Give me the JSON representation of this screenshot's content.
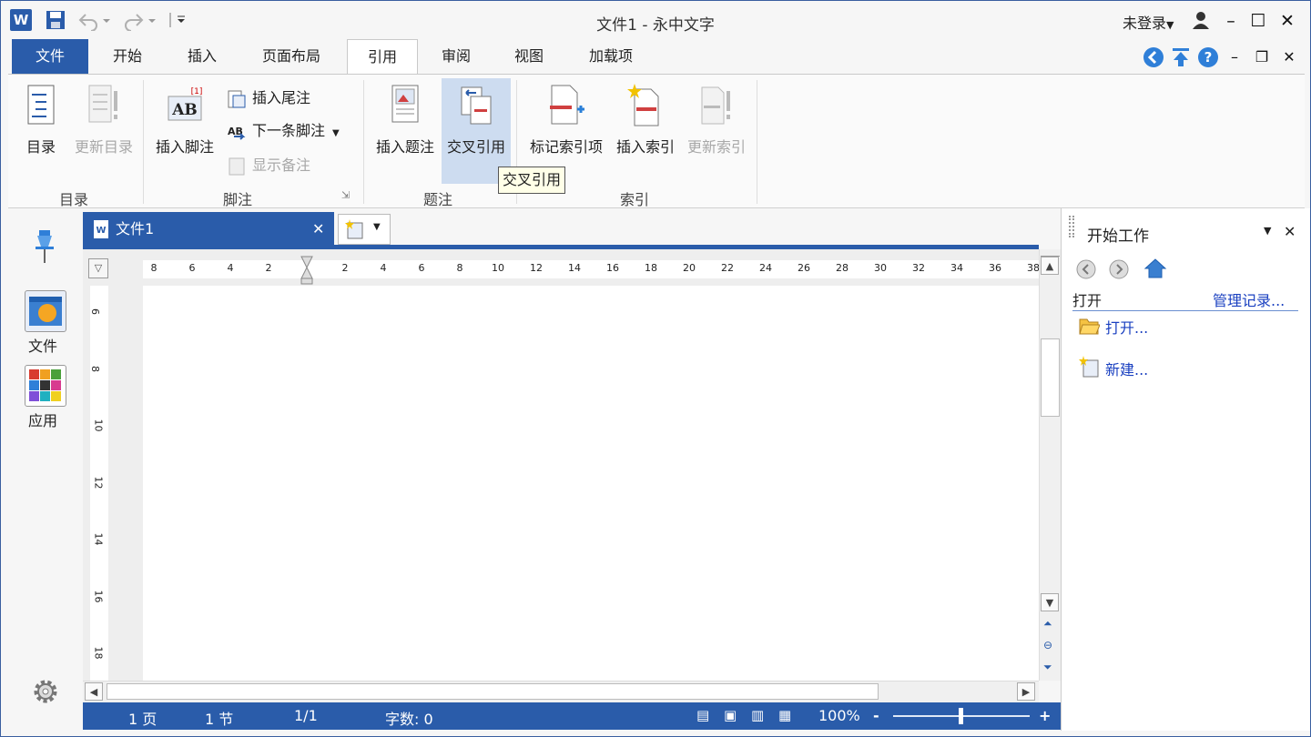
{
  "window": {
    "title": "文件1 - 永中文字",
    "app_logo": "W",
    "login": "未登录",
    "controls": [
      "minimize",
      "maximize",
      "close"
    ]
  },
  "tabs": [
    {
      "label": "文件"
    },
    {
      "label": "开始"
    },
    {
      "label": "插入"
    },
    {
      "label": "页面布局"
    },
    {
      "label": "引用"
    },
    {
      "label": "审阅"
    },
    {
      "label": "视图"
    },
    {
      "label": "加载项"
    }
  ],
  "ribbon": {
    "toc": {
      "label": "目录",
      "update": "更新目录",
      "group": "目录"
    },
    "footnote": {
      "insert": "插入脚注",
      "endnote": "插入尾注",
      "next": "下一条脚注",
      "show": "显示备注",
      "group": "脚注"
    },
    "caption": {
      "insert": "插入题注",
      "cross": "交叉引用",
      "group": "题注"
    },
    "index": {
      "mark": "标记索引项",
      "insert": "插入索引",
      "update": "更新索引",
      "group": "索引"
    },
    "tooltip": "交叉引用"
  },
  "leftbar": {
    "file": "文件",
    "apps": "应用"
  },
  "document": {
    "tab": "文件1"
  },
  "hruler": [
    "8",
    "6",
    "4",
    "2",
    "",
    "2",
    "4",
    "6",
    "8",
    "10",
    "12",
    "14",
    "16",
    "18",
    "20",
    "22",
    "24",
    "26",
    "28",
    "30",
    "32",
    "34",
    "36",
    "38"
  ],
  "vruler": [
    "6",
    "8",
    "10",
    "12",
    "14",
    "16",
    "18"
  ],
  "status": {
    "page": "1 页",
    "section": "1 节",
    "pos": "1/1",
    "words": "字数: 0",
    "zoom": "100%",
    "minus": "-",
    "plus": "+"
  },
  "taskpane": {
    "title": "开始工作",
    "open_heading": "打开",
    "manage": "管理记录...",
    "open": "打开...",
    "new": "新建..."
  }
}
